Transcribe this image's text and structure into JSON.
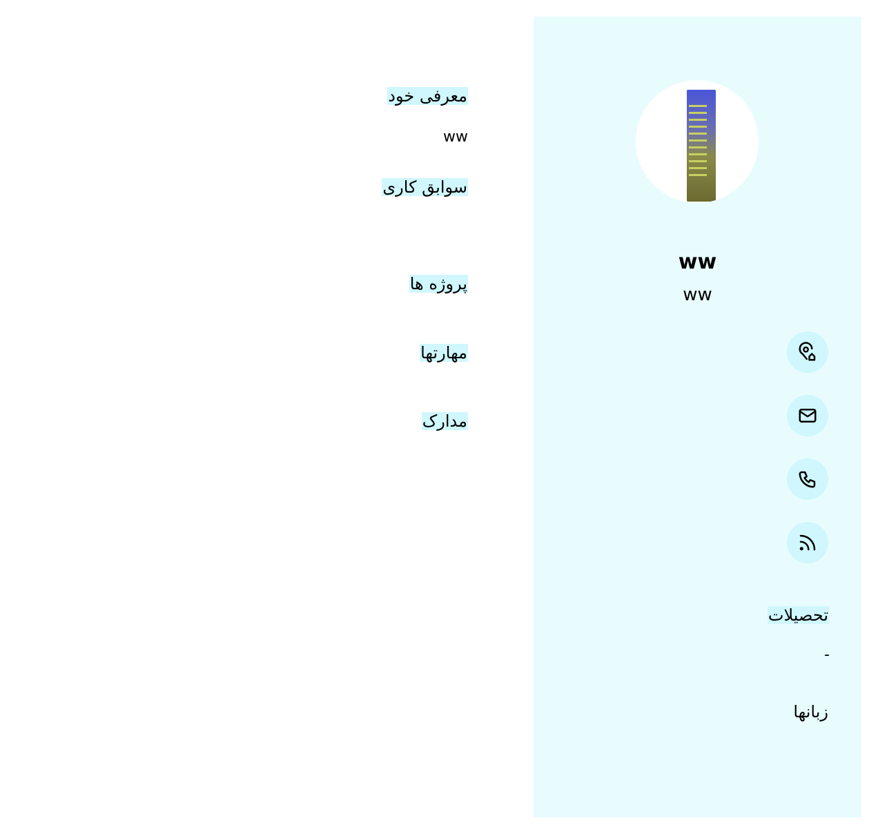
{
  "profile": {
    "name": "ww",
    "job_title": "ww",
    "avatar": "profile-photo"
  },
  "contacts": [
    {
      "icon": "location-home-icon"
    },
    {
      "icon": "mail-icon"
    },
    {
      "icon": "phone-icon"
    },
    {
      "icon": "rss-icon"
    }
  ],
  "sidebar": {
    "education_heading": "تحصیلات",
    "education_value": "-",
    "languages_heading": "زبانها"
  },
  "main": {
    "about_heading": "معرفی خود",
    "about_value": "ww",
    "experience_heading": "سوابق کاری",
    "projects_heading": "پروژه ها",
    "skills_heading": "مهارتها",
    "certificates_heading": "مدارک"
  },
  "colors": {
    "sidebar_bg": "#e8fcfe",
    "accent": "#cff7fd"
  }
}
